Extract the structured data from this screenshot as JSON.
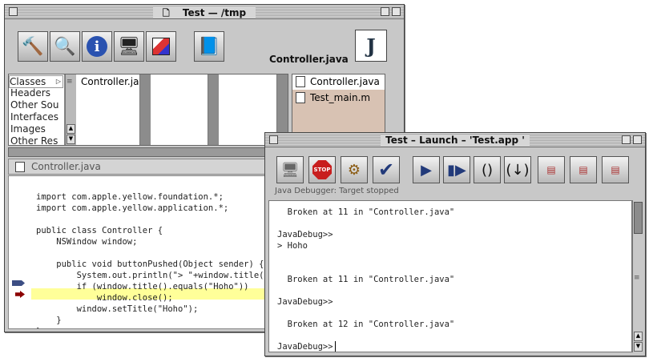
{
  "main_window": {
    "title": "Test — /tmp",
    "current_file_label": "Controller.java",
    "browser_categories": [
      "Classes",
      "Headers",
      "Other Sou",
      "Interfaces",
      "Images",
      "Other Res"
    ],
    "browser_col2": [
      "Controller.ja"
    ],
    "files": [
      "Controller.java",
      "Test_main.m"
    ],
    "editor_title": "Controller.java",
    "code": [
      "import com.apple.yellow.foundation.*;",
      "import com.apple.yellow.application.*;",
      "",
      "public class Controller {",
      "    NSWindow window;",
      "",
      "    public void buttonPushed(Object sender) {",
      "        System.out.println(\"> \"+window.title());",
      "        if (window.title().equals(\"Hoho\"))",
      "            window.close();",
      "        window.setTitle(\"Hoho\");",
      "    }",
      "}"
    ],
    "toolbar_icons": [
      "hammer-icon",
      "magnifier-icon",
      "info-icon",
      "monitor-icon",
      "cube-icon",
      "help-book-icon"
    ],
    "file_icon": "java-file-icon"
  },
  "launch_window": {
    "title": "Test – Launch – 'Test.app '",
    "status": "Java Debugger: Target stopped",
    "toolbar_icons": [
      "monitor-icon",
      "stop-icon",
      "gear-icon",
      "check-icon",
      "play-icon",
      "continue-icon",
      "step-over-icon",
      "step-into-icon",
      "frame-up-icon",
      "frame-delete-icon",
      "frame-print-icon"
    ],
    "stop_label": "STOP",
    "console": [
      "  Broken at 11 in \"Controller.java\"",
      "",
      "JavaDebug>>",
      "> Hoho",
      "",
      "",
      "  Broken at 11 in \"Controller.java\"",
      "",
      "JavaDebug>>",
      "",
      "",
      "  Broken at 12 in \"Controller.java\"",
      "",
      "",
      "JavaDebug>> "
    ]
  },
  "colors": {
    "highlight_line": "#ffff99",
    "breakpoint_marker": "#8b0000",
    "current_pc_marker": "#3c4e84",
    "file_selected_bg": "#d8c2b3"
  }
}
